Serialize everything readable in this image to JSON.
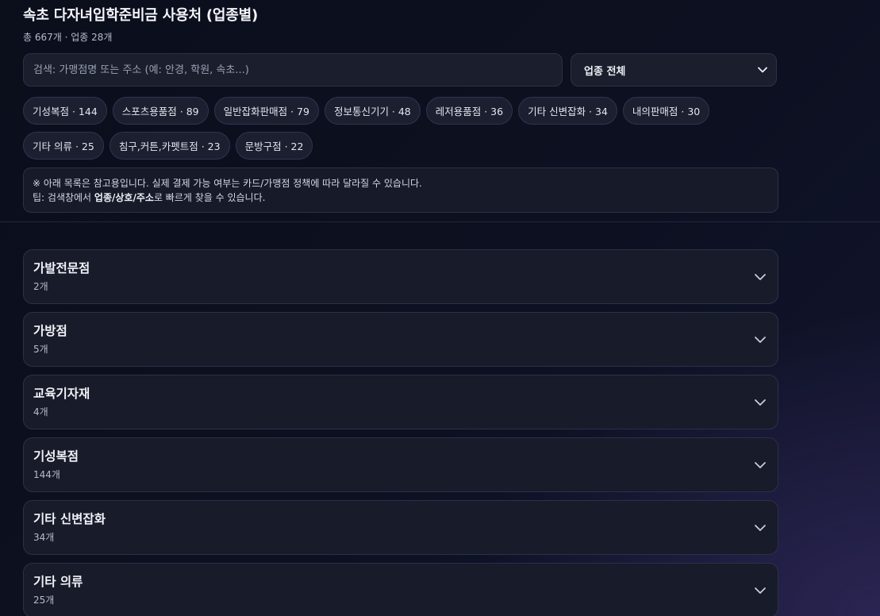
{
  "header": {
    "title": "속초 다자녀입학준비금 사용처 (업종별)",
    "subtitle": "총 667개 · 업종 28개"
  },
  "search": {
    "placeholder": "검색: 가맹점명 또는 주소 (예: 안경, 학원, 속초...)",
    "value": ""
  },
  "category_select": {
    "selected": "업종 전체"
  },
  "chips": [
    "기성복점 · 144",
    "스포츠용품점 · 89",
    "일반잡화판매점 · 79",
    "정보통신기기 · 48",
    "레저용품점 · 36",
    "기타 신변잡화 · 34",
    "내의판매점 · 30",
    "기타 의류 · 25",
    "침구,커튼,카펫트점 · 23",
    "문방구점 · 22"
  ],
  "notice": {
    "line1": "※ 아래 목록은 참고용입니다. 실제 결제 가능 여부는 카드/가맹점 정책에 따라 달라질 수 있습니다.",
    "tip_prefix": "팁: 검색창에서 ",
    "tip_bold": "업종/상호/주소",
    "tip_suffix": "로 빠르게 찾을 수 있습니다."
  },
  "categories": [
    {
      "name": "가발전문점",
      "count": "2개"
    },
    {
      "name": "가방점",
      "count": "5개"
    },
    {
      "name": "교육기자재",
      "count": "4개"
    },
    {
      "name": "기성복점",
      "count": "144개"
    },
    {
      "name": "기타 신변잡화",
      "count": "34개"
    },
    {
      "name": "기타 의류",
      "count": "25개"
    }
  ],
  "icons": {
    "select_chevron": "chevron-down-icon",
    "card_chevron": "chevron-down-icon"
  },
  "colors": {
    "background": "#0b0f1c",
    "card": "#171b2a",
    "border": "#2b3148",
    "text": "#e8eaf0",
    "muted": "#b7bccb"
  }
}
